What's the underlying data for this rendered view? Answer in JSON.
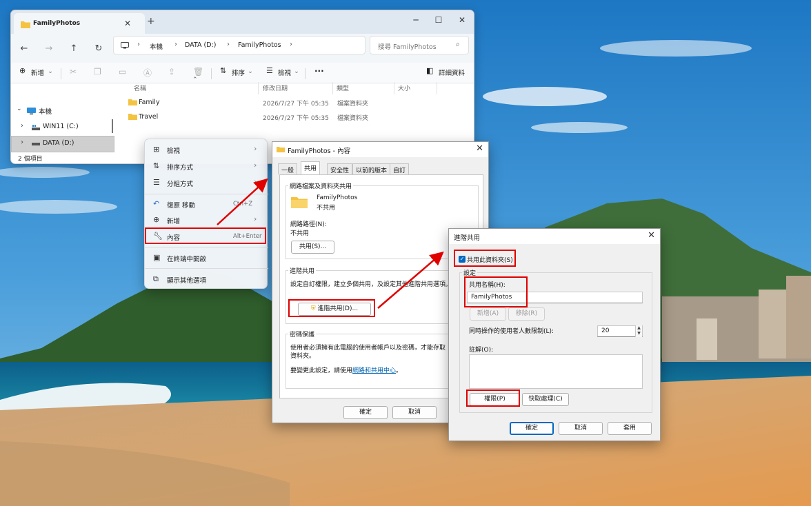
{
  "explorer": {
    "tab_title": "FamilyPhotos",
    "breadcrumb": [
      "本機",
      "DATA (D:)",
      "FamilyPhotos"
    ],
    "search_placeholder": "搜尋 FamilyPhotos",
    "toolbar": {
      "new_label": "新增",
      "sort_label": "排序",
      "view_label": "檢視",
      "details_label": "詳細資料"
    },
    "sidebar": [
      {
        "label": "本機",
        "icon": "computer-icon"
      },
      {
        "label": "WIN11 (C:)",
        "icon": "windows-drive-icon"
      },
      {
        "label": "DATA (D:)",
        "icon": "drive-icon",
        "selected": true
      }
    ],
    "columns": [
      "名稱",
      "修改日期",
      "類型",
      "大小"
    ],
    "rows": [
      {
        "name": "Family",
        "date": "2026/7/27 下午 05:35",
        "type": "檔案資料夾"
      },
      {
        "name": "Travel",
        "date": "2026/7/27 下午 05:35",
        "type": "檔案資料夾"
      }
    ],
    "status": "2 個項目"
  },
  "context_menu": {
    "items": [
      {
        "label": "檢視",
        "icon": "grid-icon",
        "shortcut": "",
        "submenu": true
      },
      {
        "label": "排序方式",
        "icon": "sort-icon",
        "shortcut": "",
        "submenu": true
      },
      {
        "label": "分組方式",
        "icon": "group-icon",
        "shortcut": "",
        "submenu": true
      },
      {
        "label": "復原 移動",
        "icon": "undo-icon",
        "shortcut": "Ctrl+Z",
        "submenu": false
      },
      {
        "label": "新增",
        "icon": "plus-icon",
        "shortcut": "",
        "submenu": true
      },
      {
        "label": "內容",
        "icon": "wrench-icon",
        "shortcut": "Alt+Enter",
        "submenu": false
      },
      {
        "label": "在終端中開啟",
        "icon": "terminal-icon",
        "shortcut": "",
        "submenu": false
      },
      {
        "label": "顯示其他選項",
        "icon": "more-options-icon",
        "shortcut": "",
        "submenu": false
      }
    ]
  },
  "properties": {
    "title": "FamilyPhotos - 內容",
    "tabs": [
      "一般",
      "共用",
      "安全性",
      "以前的版本",
      "自訂"
    ],
    "active_tab": "共用",
    "net_group_title": "網路檔案及資料夾共用",
    "folder_name": "FamilyPhotos",
    "share_state": "不共用",
    "net_path_label": "網路路徑(N):",
    "net_path_value": "不共用",
    "share_button": "共用(S)...",
    "adv_group_title": "進階共用",
    "adv_desc": "設定自訂權限，建立多個共用，及設定其他進階共用選項。",
    "adv_button": "進階共用(D)...",
    "pwd_group_title": "密碼保護",
    "pwd_desc_1": "使用者必須擁有此電腦的使用者帳戶以及密碼，才能存取",
    "pwd_desc_2": "資料夾。",
    "pwd_change_prefix": "要變更此設定，請使用",
    "pwd_link": "網路和共用中心",
    "pwd_change_suffix": "。",
    "buttons": {
      "ok": "確定",
      "cancel": "取消"
    }
  },
  "advanced": {
    "title": "進階共用",
    "share_checkbox": "共用此資料夾(S)",
    "checked": true,
    "settings_label": "設定",
    "share_name_label": "共用名稱(H):",
    "share_name_value": "FamilyPhotos",
    "add_button": "新增(A)",
    "remove_button": "移除(R)",
    "limit_label": "同時操作的使用者人數限制(L):",
    "limit_value": "20",
    "comment_label": "註解(O):",
    "permissions_button": "權限(P)",
    "caching_button": "快取處理(C)",
    "buttons": {
      "ok": "確定",
      "cancel": "取消",
      "apply": "套用"
    }
  },
  "colors": {
    "highlight": "#e00000",
    "accent": "#0067c0",
    "folder": "#f4c342"
  }
}
